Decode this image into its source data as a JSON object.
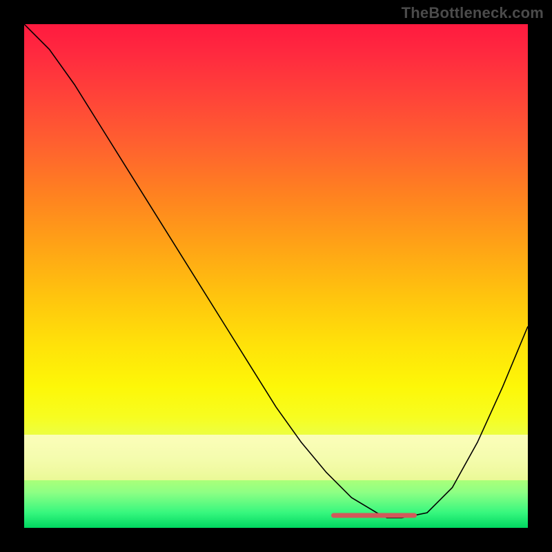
{
  "watermark": "TheBottleneck.com",
  "chart_data": {
    "type": "line",
    "title": "",
    "xlabel": "",
    "ylabel": "",
    "xlim": [
      0,
      100
    ],
    "ylim": [
      0,
      100
    ],
    "grid": false,
    "series": [
      {
        "name": "curve",
        "x": [
          0,
          5,
          10,
          15,
          20,
          25,
          30,
          35,
          40,
          45,
          50,
          55,
          60,
          65,
          70,
          72,
          75,
          80,
          85,
          90,
          95,
          100
        ],
        "y": [
          100,
          95,
          88,
          80,
          72,
          64,
          56,
          48,
          40,
          32,
          24,
          17,
          11,
          6,
          3,
          2,
          2,
          3,
          8,
          17,
          28,
          40
        ]
      }
    ],
    "highlight_band": {
      "x_start": 61,
      "x_end": 78,
      "y": 2.5
    },
    "gradient_stops": [
      {
        "pos": 0,
        "color": "#ff1a3f"
      },
      {
        "pos": 24,
        "color": "#ff612f"
      },
      {
        "pos": 54,
        "color": "#ffc40e"
      },
      {
        "pos": 78,
        "color": "#f7fd20"
      },
      {
        "pos": 100,
        "color": "#00d760"
      }
    ]
  }
}
